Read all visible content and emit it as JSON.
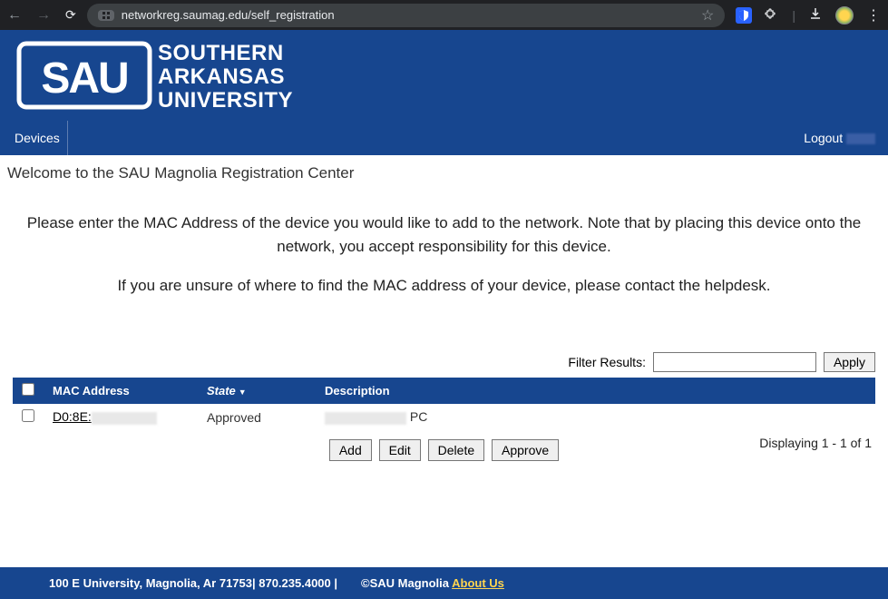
{
  "browser": {
    "url_display": "networkreg.saumag.edu/self_registration"
  },
  "branding": {
    "logo_text": "SAU",
    "line1": "SOUTHERN",
    "line2": "ARKANSAS",
    "line3": "UNIVERSITY"
  },
  "nav": {
    "devices": "Devices",
    "logout": "Logout"
  },
  "page": {
    "title": "Welcome to the SAU Magnolia Registration Center",
    "instruction1": "Please enter the MAC Address of the device you would like to add to the network. Note that by placing this device onto the network, you accept responsibility for this device.",
    "instruction2": "If you are unsure of where to find the MAC address of your device, please contact the helpdesk."
  },
  "filter": {
    "label": "Filter Results:",
    "apply": "Apply",
    "value": ""
  },
  "table": {
    "headers": {
      "mac": "MAC Address",
      "state": "State",
      "desc": "Description"
    },
    "rows": [
      {
        "mac_prefix": "D0:8E:",
        "state": "Approved",
        "desc_suffix": "PC"
      }
    ]
  },
  "actions": {
    "add": "Add",
    "edit": "Edit",
    "delete": "Delete",
    "approve": "Approve",
    "display": "Displaying 1 - 1 of 1"
  },
  "footer": {
    "address": "100 E University, Magnolia, Ar 71753| 870.235.4000 |",
    "copyright": "©SAU Magnolia ",
    "about": "About Us"
  }
}
